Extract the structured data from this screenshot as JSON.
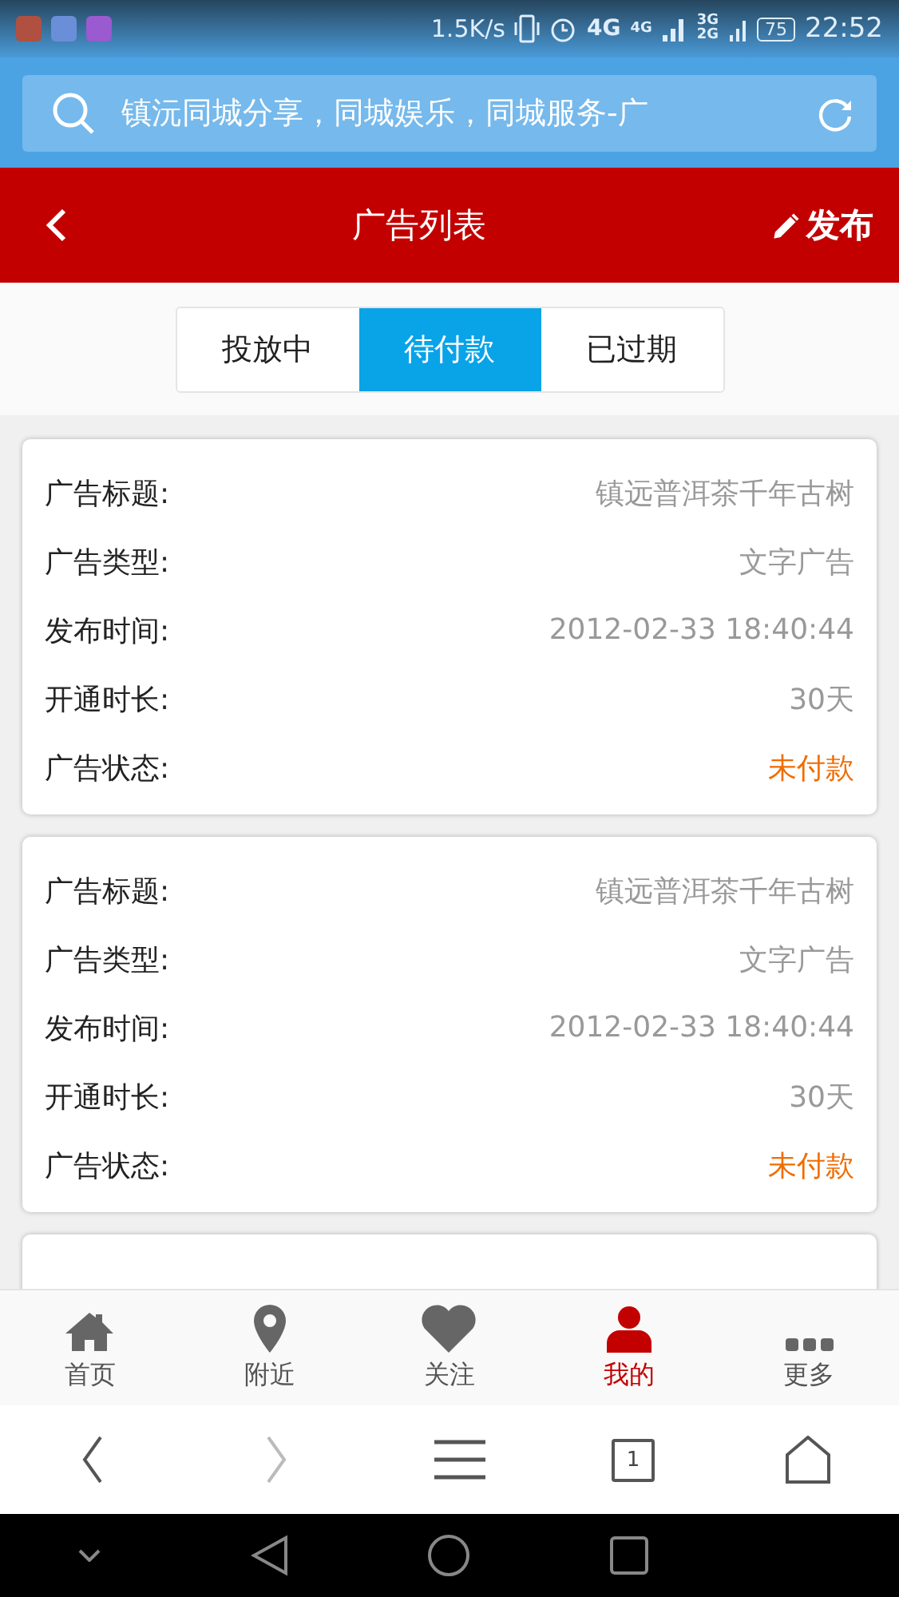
{
  "status_bar": {
    "speed": "1.5K/s",
    "network_1": "4G",
    "network_2": "4G",
    "network_3": "3G",
    "network_4": "2G",
    "battery": "75",
    "time": "22:52"
  },
  "browser": {
    "address": "镇沅同城分享，同城娱乐，同城服务-广"
  },
  "header": {
    "title": "广告列表",
    "action": "发布"
  },
  "tabs": [
    {
      "label": "投放中",
      "selected": false
    },
    {
      "label": "待付款",
      "selected": true
    },
    {
      "label": "已过期",
      "selected": false
    }
  ],
  "ads": [
    {
      "rows": [
        {
          "label": "广告标题:",
          "value": "镇远普洱茶千年古树",
          "kind": "text"
        },
        {
          "label": "广告类型:",
          "value": "文字广告",
          "kind": "text"
        },
        {
          "label": "发布时间:",
          "value": "2012-02-33 18:40:44",
          "kind": "text"
        },
        {
          "label": "开通时长:",
          "value": "30天",
          "kind": "text"
        },
        {
          "label": "广告状态:",
          "value": "未付款",
          "kind": "status"
        }
      ]
    },
    {
      "rows": [
        {
          "label": "广告标题:",
          "value": "镇远普洱茶千年古树",
          "kind": "text"
        },
        {
          "label": "广告类型:",
          "value": "文字广告",
          "kind": "text"
        },
        {
          "label": "发布时间:",
          "value": "2012-02-33 18:40:44",
          "kind": "text"
        },
        {
          "label": "开通时长:",
          "value": "30天",
          "kind": "text"
        },
        {
          "label": "广告状态:",
          "value": "未付款",
          "kind": "status"
        }
      ]
    }
  ],
  "bottom_nav": [
    {
      "label": "首页",
      "kind": "home",
      "selected": false
    },
    {
      "label": "附近",
      "kind": "pin",
      "selected": false
    },
    {
      "label": "关注",
      "kind": "heart",
      "selected": false
    },
    {
      "label": "我的",
      "kind": "user",
      "selected": true
    },
    {
      "label": "更多",
      "kind": "more",
      "selected": false
    }
  ],
  "browser_toolbar": {
    "back_disabled": false,
    "forward_disabled": true,
    "tab_count": "1"
  }
}
